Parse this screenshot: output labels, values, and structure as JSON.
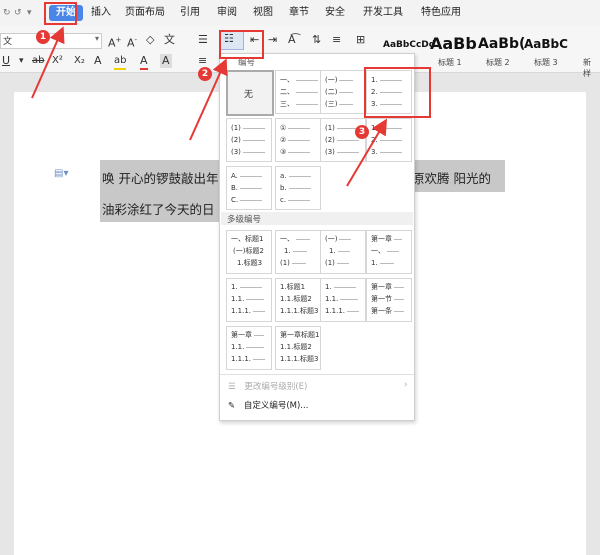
{
  "menu": {
    "items": [
      "开始",
      "插入",
      "页面布局",
      "引用",
      "审阅",
      "视图",
      "章节",
      "安全",
      "开发工具",
      "特色应用"
    ]
  },
  "toolbar": {
    "font_name_fragment": "文",
    "font_grow": "A⁺",
    "font_shrink": "A⁻",
    "styles": [
      {
        "preview": "AaBbCcDd",
        "label": ""
      },
      {
        "preview": "AaBb",
        "label": "标题 1"
      },
      {
        "preview": "AaBb(",
        "label": "标题 2"
      },
      {
        "preview": "AaBbC",
        "label": "标题 3"
      },
      {
        "preview": "",
        "label": "新样"
      }
    ]
  },
  "document": {
    "line1_left": "唤  开心的锣鼓敲出年",
    "line1_right": "原欢腾  阳光的",
    "line2": "油彩涂红了今天的日"
  },
  "numbering_menu": {
    "header": "编号",
    "none_label": "无",
    "multilevel_header": "多级编号",
    "change_level": "更改编号级别(E)",
    "custom": "自定义编号(M)...",
    "single": [
      [
        "一、",
        "二、",
        "三、"
      ],
      [
        "(一)",
        "(二)",
        "(三)"
      ],
      [
        "1.",
        "2.",
        "3."
      ],
      [
        "(1)",
        "(2)",
        "(3)"
      ],
      [
        "①",
        "②",
        "③"
      ],
      [
        "(1)",
        "(2)",
        "(3)"
      ],
      [
        "1.",
        "2.",
        "3."
      ],
      [
        "A.",
        "B.",
        "C."
      ],
      [
        "a.",
        "b.",
        "c."
      ]
    ],
    "multi": [
      [
        "一、标题1",
        "(一)标题2",
        "1.标题3"
      ],
      [
        "一、",
        "1.",
        "(1)"
      ],
      [
        "(一)",
        "1.",
        "(1)"
      ],
      [
        "第一章",
        "一、",
        "1."
      ],
      [
        "1.",
        "1.1.",
        "1.1.1."
      ],
      [
        "1.标题1",
        "1.1.标题2",
        "1.1.1.标题3"
      ],
      [
        "1.",
        "1.1.",
        "1.1.1."
      ],
      [
        "第一章",
        "第一节",
        "第一条"
      ],
      [
        "第一章",
        "1.1.",
        "1.1.1."
      ],
      [
        "第一章标题1",
        "1.1.标题2",
        "1.1.1.标题3"
      ]
    ]
  },
  "callouts": [
    "1",
    "2",
    "3"
  ],
  "colors": {
    "accent": "#4a86e8",
    "annotation": "#e53935"
  }
}
